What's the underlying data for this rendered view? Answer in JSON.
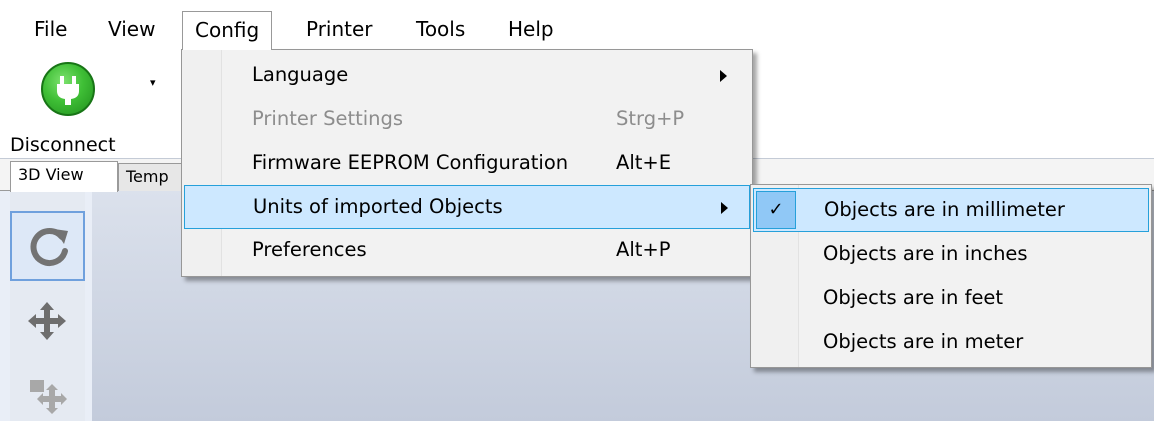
{
  "menubar": {
    "items": [
      "File",
      "View",
      "Config",
      "Printer",
      "Tools",
      "Help"
    ],
    "open_item": "Config"
  },
  "toolbar": {
    "connect_label": "Disconnect",
    "connect_icon": "power-plug-icon",
    "dropdown_glyph": "▾"
  },
  "tabs": [
    "3D View",
    "Temp"
  ],
  "side_tools": [
    "refresh-icon",
    "move-icon",
    "move-object-icon"
  ],
  "config_menu": {
    "items": [
      {
        "label": "Language",
        "shortcut": "",
        "submenu": true,
        "disabled": false
      },
      {
        "label": "Printer Settings",
        "shortcut": "Strg+P",
        "submenu": false,
        "disabled": true
      },
      {
        "label": "Firmware EEPROM Configuration",
        "shortcut": "Alt+E",
        "submenu": false,
        "disabled": false
      },
      {
        "label": "Units of imported Objects",
        "shortcut": "",
        "submenu": true,
        "disabled": false
      },
      {
        "label": "Preferences",
        "shortcut": "Alt+P",
        "submenu": false,
        "disabled": false
      }
    ]
  },
  "units_submenu": {
    "check_glyph": "✓",
    "items": [
      {
        "label": "Objects are in millimeter",
        "checked": true
      },
      {
        "label": "Objects are in inches",
        "checked": false
      },
      {
        "label": "Objects are in feet",
        "checked": false
      },
      {
        "label": "Objects are in meter",
        "checked": false
      }
    ]
  },
  "colors": {
    "highlight": "#cde8ff",
    "highlight_border": "#26a0da",
    "connect_green": "#3fbf36"
  }
}
